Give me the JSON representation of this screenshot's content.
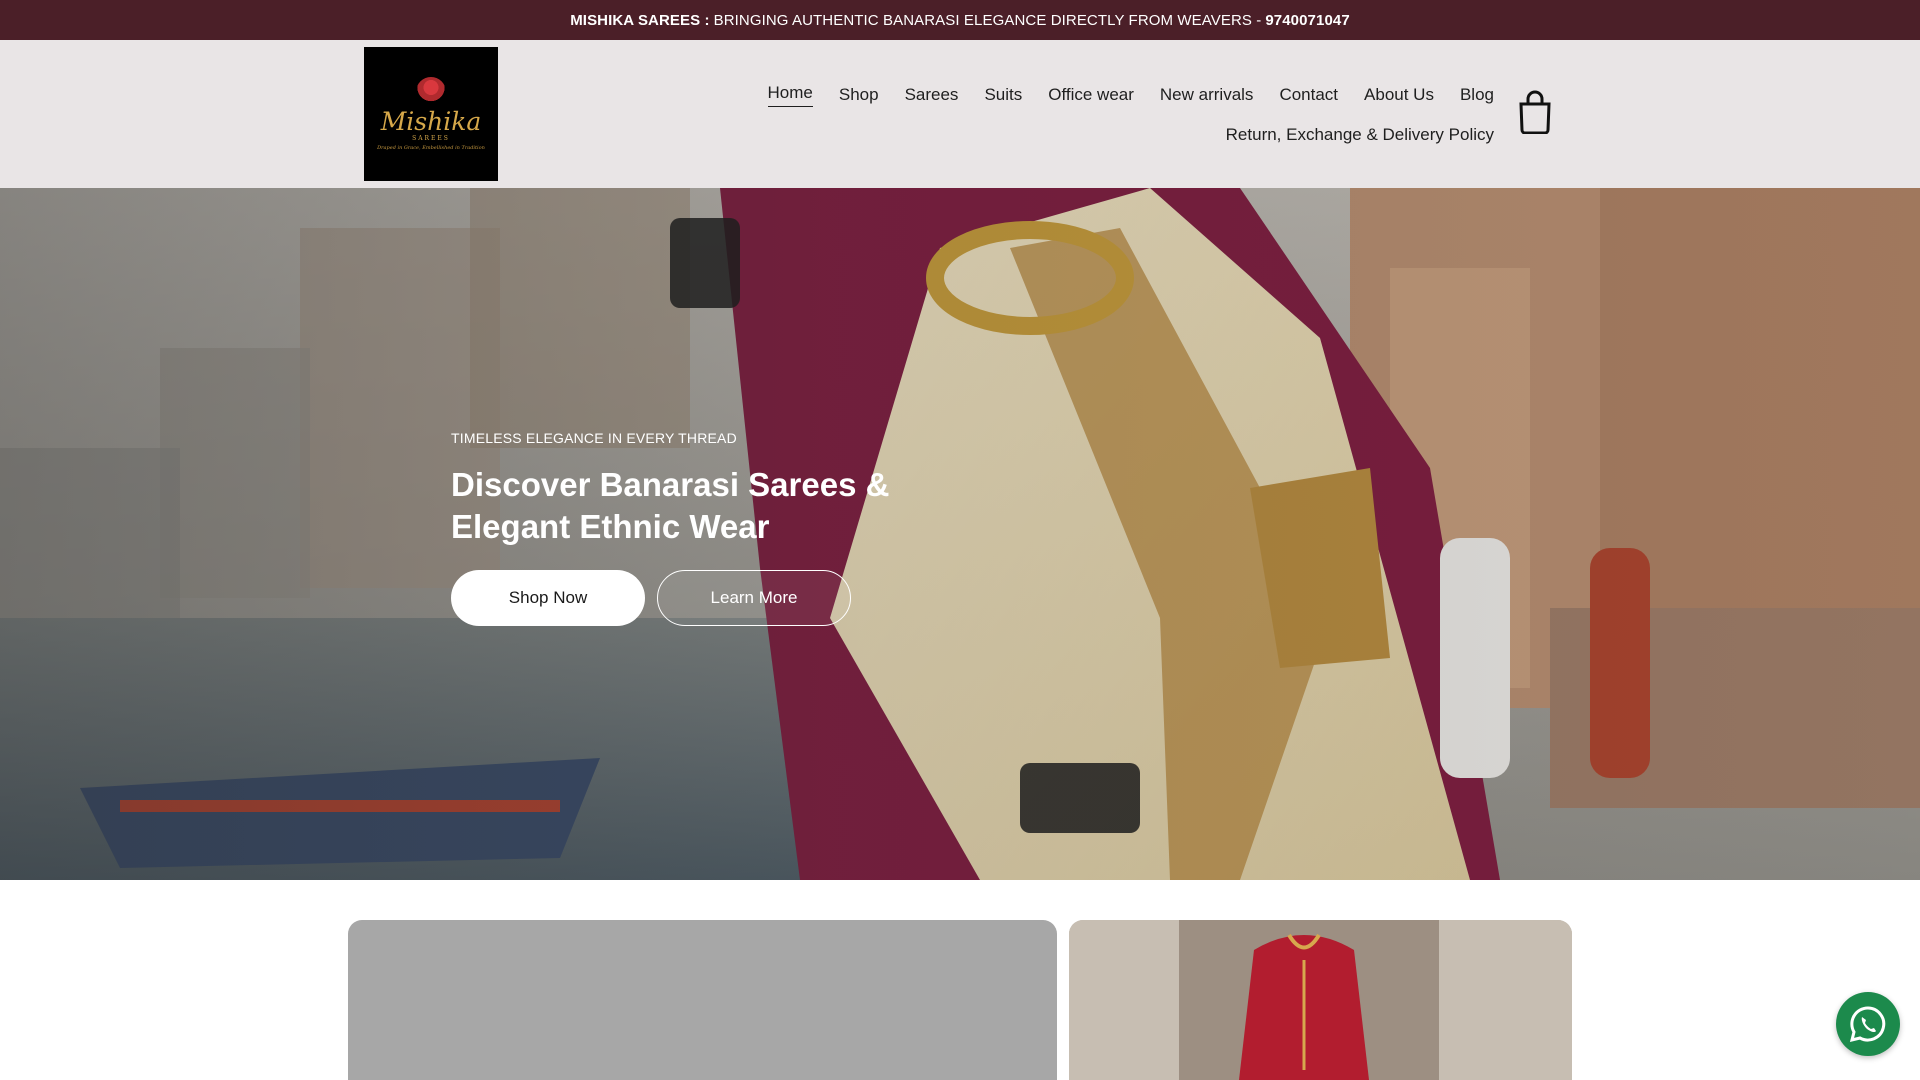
{
  "announcement": {
    "brand": "MISHIKA SAREES :",
    "message": "BRINGING AUTHENTIC BANARASI ELEGANCE DIRECTLY FROM WEAVERS -",
    "phone": "9740071047"
  },
  "logo": {
    "brand": "Mishika",
    "sub": "SAREES",
    "tagline": "Draped in Grace, Embellished in Tradition"
  },
  "nav": {
    "row1": [
      "Home",
      "Shop",
      "Sarees",
      "Suits",
      "Office wear",
      "New arrivals",
      "Contact",
      "About Us",
      "Blog"
    ],
    "row2": [
      "Return, Exchange & Delivery Policy"
    ],
    "active": "Home"
  },
  "hero": {
    "eyebrow": "TIMELESS ELEGANCE IN EVERY THREAD",
    "title": "Discover Banarasi Sarees & Elegant Ethnic Wear",
    "primary_button": "Shop Now",
    "secondary_button": "Learn More"
  },
  "icons": {
    "cart": "shopping-bag-icon",
    "chat": "whatsapp-icon"
  },
  "colors": {
    "announcement_bg": "#4b1f28",
    "header_bg": "#e9e5e6",
    "whatsapp": "#1c8a4c"
  }
}
